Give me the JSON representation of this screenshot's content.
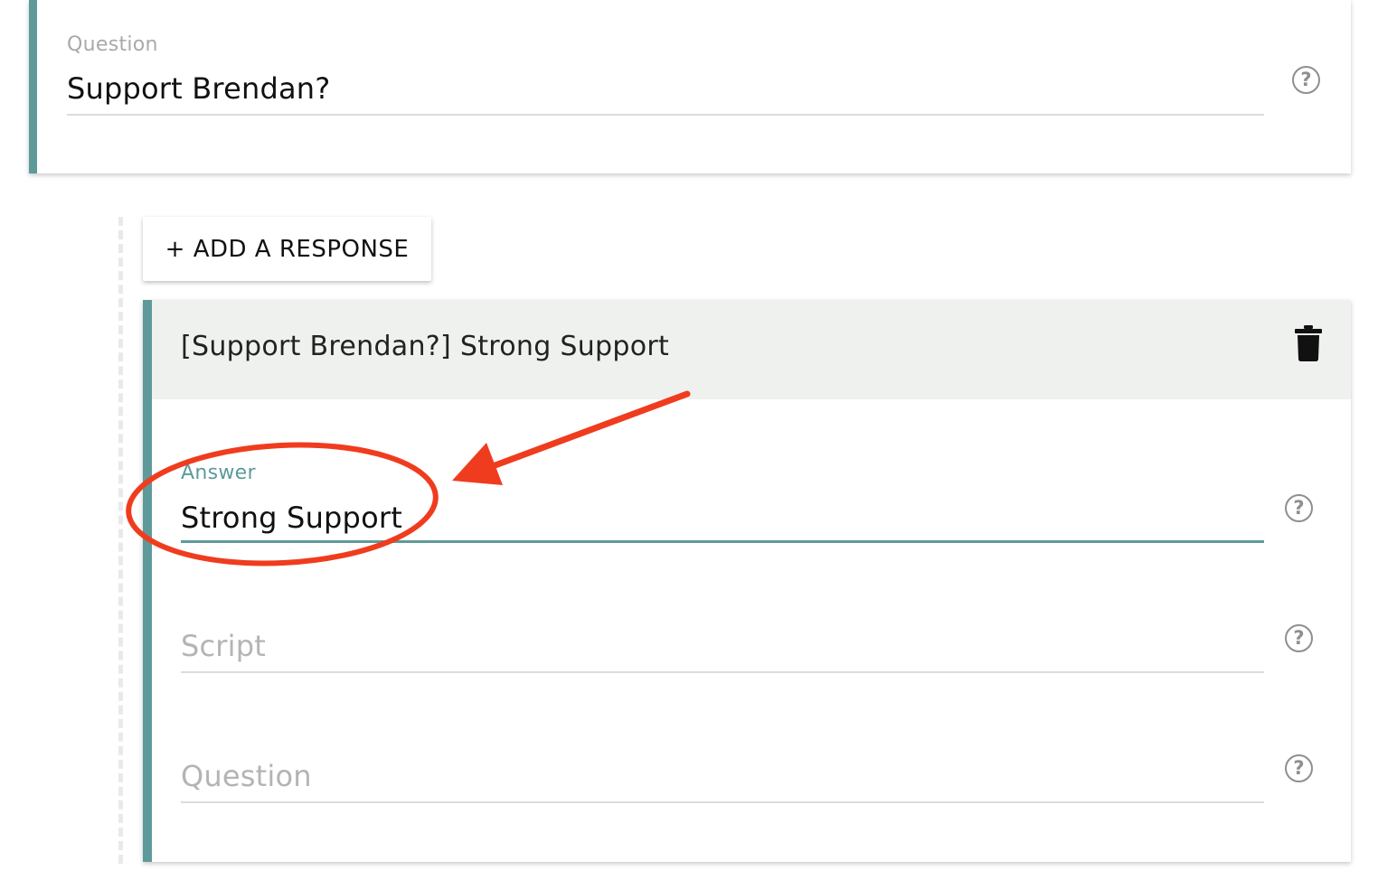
{
  "question_card": {
    "label": "Question",
    "value": "Support Brendan?"
  },
  "add_response_button": {
    "label": "+ ADD A RESPONSE"
  },
  "response_card": {
    "title": "[Support Brendan?] Strong Support",
    "answer": {
      "label": "Answer",
      "value": "Strong Support"
    },
    "script": {
      "placeholder": "Script"
    },
    "question": {
      "placeholder": "Question"
    }
  },
  "icons": {
    "help": "help-circle-icon",
    "delete": "trash-icon"
  },
  "colors": {
    "accent": "#5e9a9a",
    "header_bg": "#eff1ef",
    "annotation": "#f03c1e"
  }
}
